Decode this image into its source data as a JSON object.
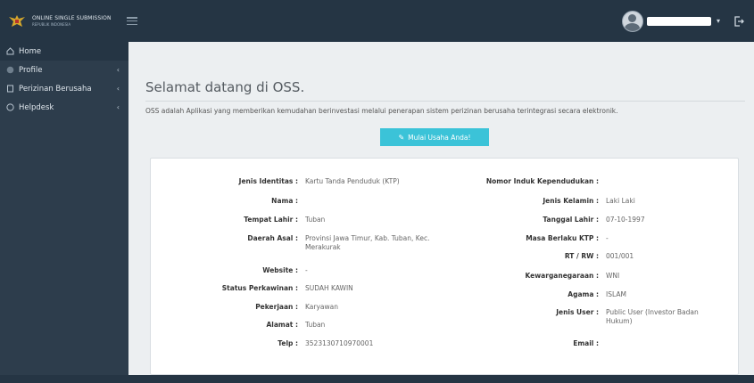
{
  "app": {
    "logo_line1": "ONLINE SINGLE SUBMISSION",
    "logo_line2": "REPUBLIK INDONESIA"
  },
  "sidebar": {
    "items": [
      {
        "label": "Home",
        "icon": "home-icon"
      },
      {
        "label": "Profile",
        "icon": "user-icon"
      },
      {
        "label": "Perizinan Berusaha",
        "icon": "document-icon"
      },
      {
        "label": "Helpdesk",
        "icon": "help-icon"
      }
    ]
  },
  "main": {
    "title": "Selamat datang di OSS.",
    "description": "OSS adalah Aplikasi yang memberikan kemudahan berinvestasi melalui penerapan sistem perizinan berusaha terintegrasi secara elektronik.",
    "start_button": "Mulai Usaha Anda!"
  },
  "profile": {
    "left": [
      {
        "label": "Jenis Identitas :",
        "value": "Kartu Tanda Penduduk (KTP)"
      },
      {
        "label": "Nama :",
        "value": ""
      },
      {
        "label": "Tempat Lahir :",
        "value": "Tuban"
      },
      {
        "label": "Daerah Asal :",
        "value": "Provinsi Jawa Timur, Kab. Tuban, Kec. Merakurak"
      },
      {
        "label": "Website :",
        "value": "-"
      },
      {
        "label": "Status Perkawinan :",
        "value": "SUDAH KAWIN"
      },
      {
        "label": "Pekerjaan :",
        "value": "Karyawan"
      },
      {
        "label": "Alamat :",
        "value": "Tuban"
      },
      {
        "label": "Telp :",
        "value": "3523130710970001"
      }
    ],
    "right": [
      {
        "label": "Nomor Induk Kependudukan :",
        "value": ""
      },
      {
        "label": "Jenis Kelamin :",
        "value": "Laki Laki"
      },
      {
        "label": "Tanggal Lahir :",
        "value": "07-10-1997"
      },
      {
        "label": "Masa Berlaku KTP :",
        "value": "-"
      },
      {
        "label": "RT / RW :",
        "value": "001/001"
      },
      {
        "label": "Kewarganegaraan :",
        "value": "WNI"
      },
      {
        "label": "Agama :",
        "value": "ISLAM"
      },
      {
        "label": "Jenis User :",
        "value": "Public User (Investor Badan Hukum)"
      },
      {
        "label": "Email :",
        "value": ""
      }
    ]
  },
  "colors": {
    "topbar": "#253544",
    "sidebar": "#2d3d4c",
    "accent": "#3bc3d8"
  }
}
